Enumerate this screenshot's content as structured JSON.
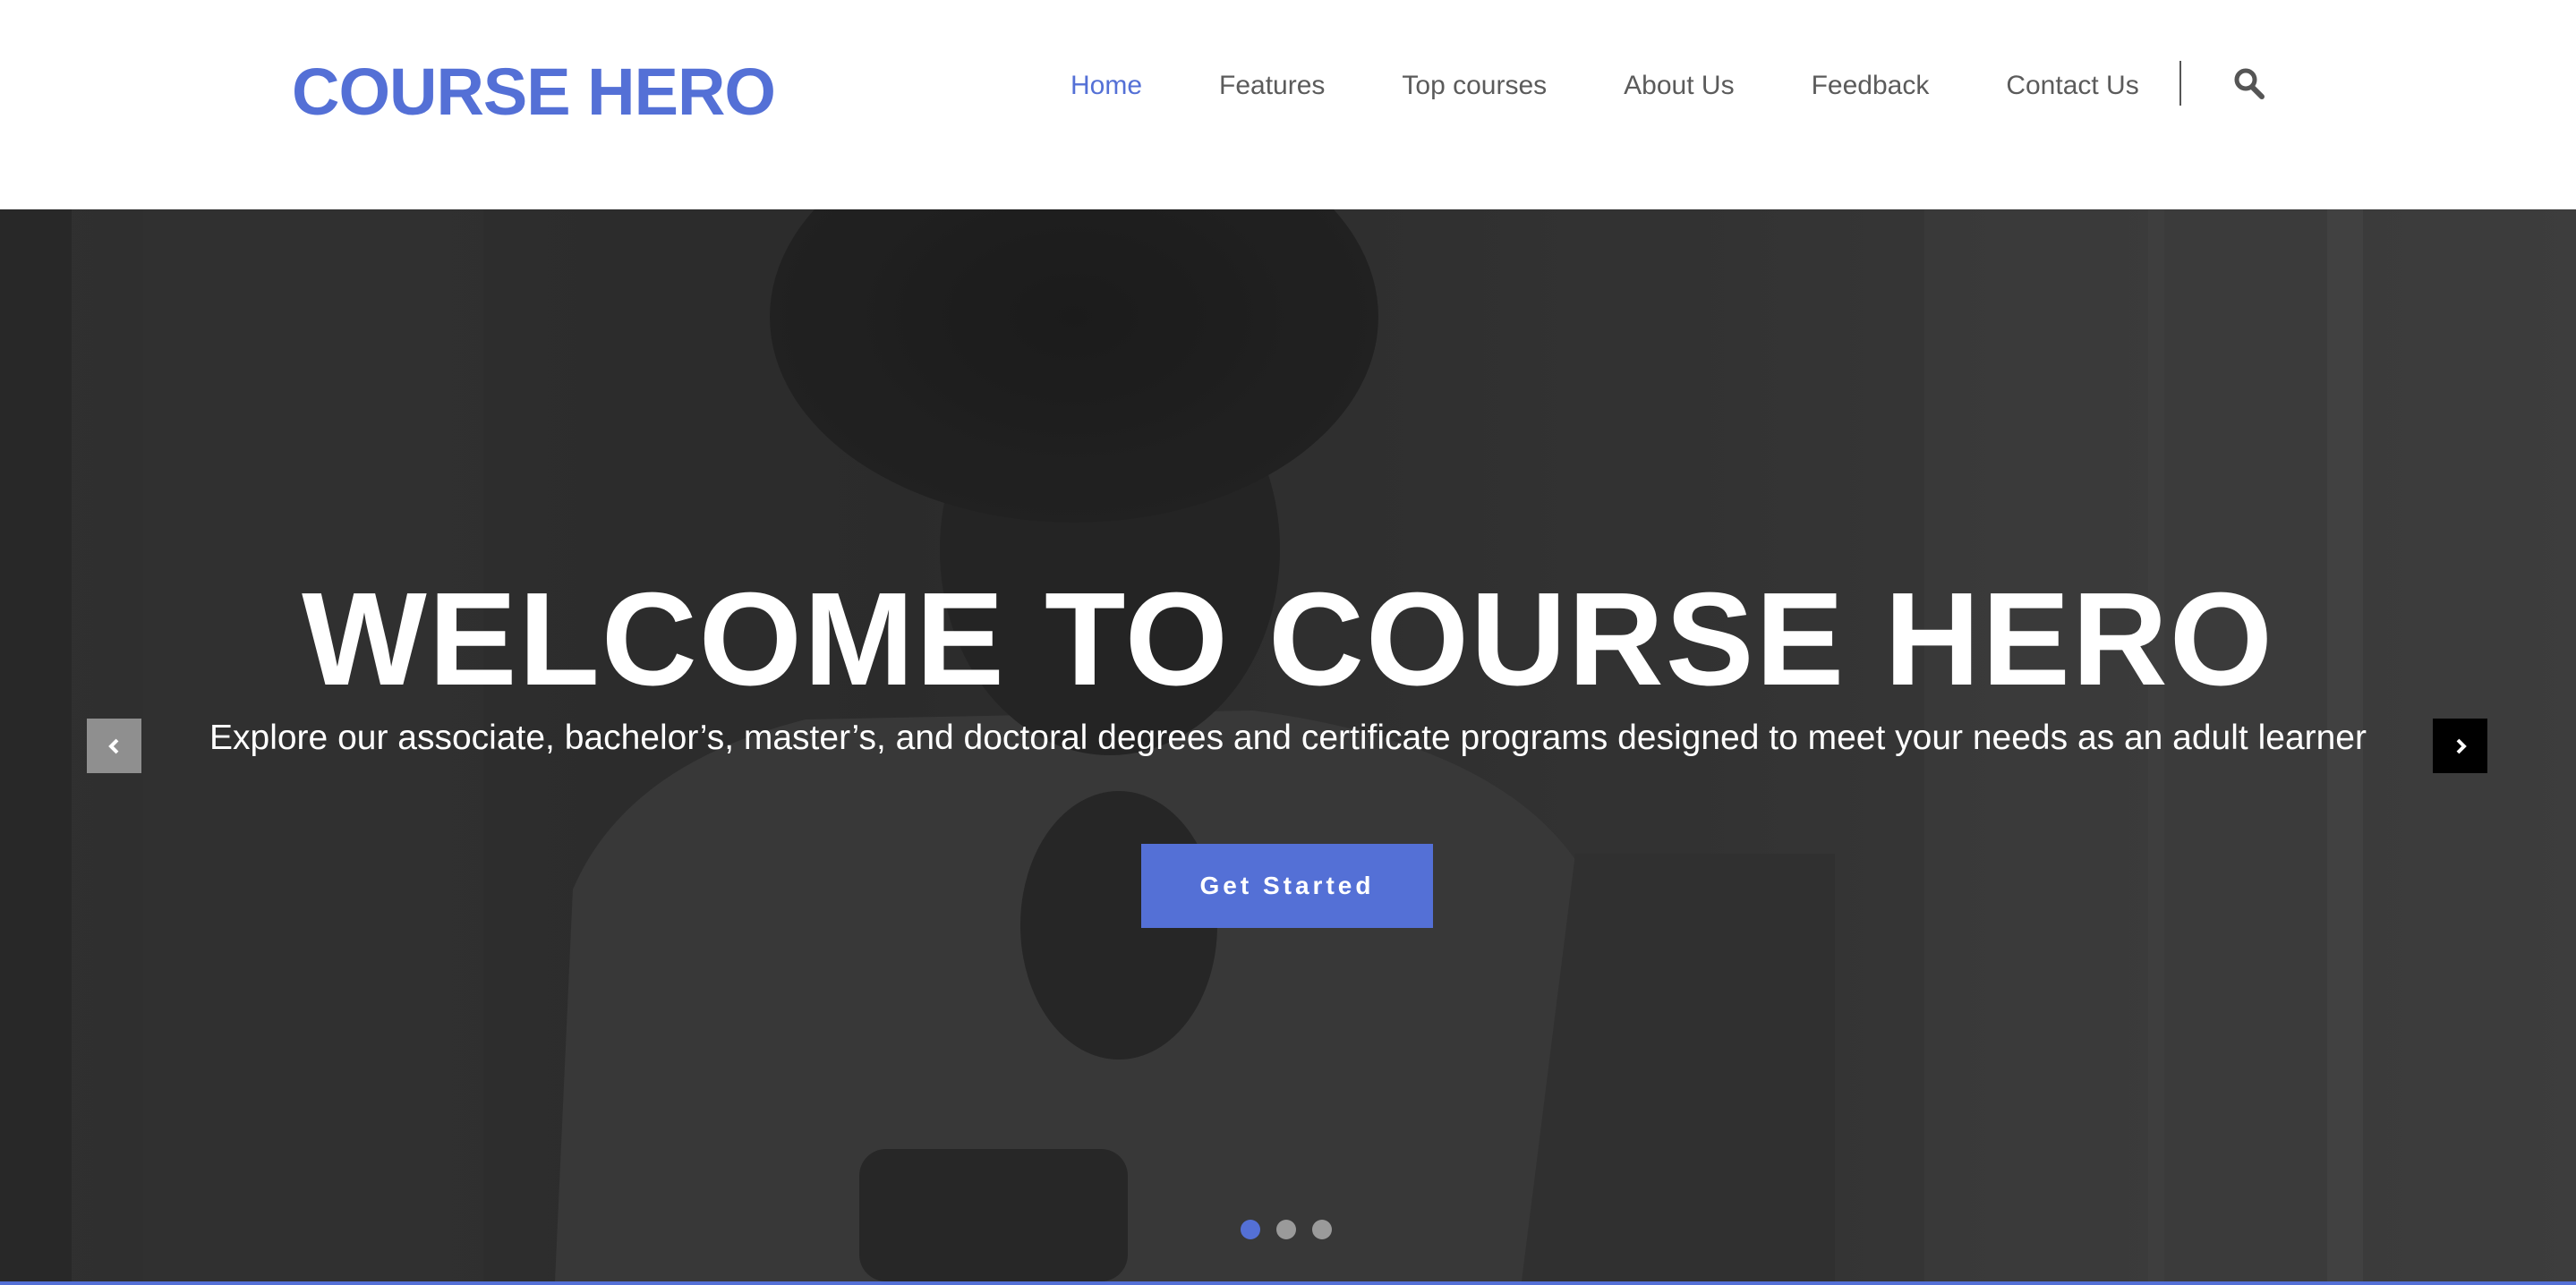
{
  "brand": {
    "name": "COURSE HERO",
    "accent_color": "#5470d6"
  },
  "nav": {
    "items": [
      {
        "label": "Home",
        "active": true
      },
      {
        "label": "Features",
        "active": false
      },
      {
        "label": "Top courses",
        "active": false
      },
      {
        "label": "About Us",
        "active": false
      },
      {
        "label": "Feedback",
        "active": false
      },
      {
        "label": "Contact Us",
        "active": false
      }
    ],
    "search_icon": "search-icon"
  },
  "hero": {
    "title": "WELCOME TO COURSE HERO",
    "subtitle": "Explore our associate, bachelor’s, master’s, and doctoral degrees and certificate programs designed to meet your needs as an adult learner",
    "cta_label": "Get Started",
    "prev_icon": "chevron-left-icon",
    "next_icon": "chevron-right-icon",
    "slides_count": 3,
    "active_slide": 1
  }
}
